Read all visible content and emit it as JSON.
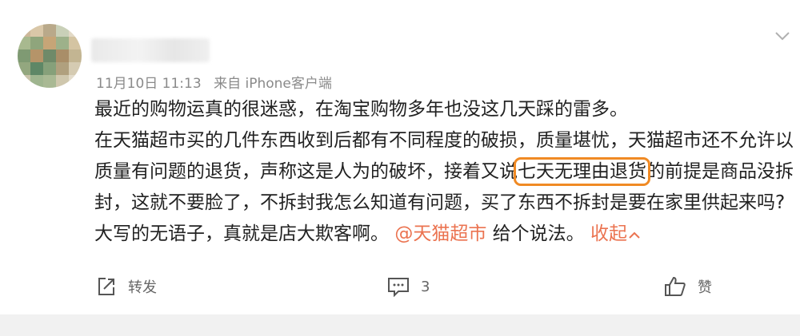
{
  "post": {
    "meta": {
      "time": "11月10日 11:13",
      "source": "来自 iPhone客户端"
    },
    "lines": [
      "最近的购物运真的很迷惑，在淘宝购物多年也没这几天踩的雷多。",
      "在天猫超市买的几件东西收到后都有不同程度的破损，质量堪忧，天猫超市还不允许以",
      {
        "before": "质量有问题的退货，声称这是人为的破坏，接着又说",
        "highlight": "七天无理由退货",
        "after": "的前提是商品没拆"
      },
      "封，这就不要脸了，不拆封我怎么知道有问题，买了东西不拆封是要在家里供起来吗?",
      {
        "before": "大写的无语子，真就是店大欺客啊。",
        "mention": "@天猫超市",
        "middle": " 给个说法。",
        "collapse": "收起"
      }
    ]
  },
  "actions": {
    "repost": "转发",
    "comment_count": "3",
    "like": "赞"
  },
  "colors": {
    "accent": "#eb7350",
    "highlight_box": "#f08a24",
    "meta": "#8a8a8a"
  }
}
